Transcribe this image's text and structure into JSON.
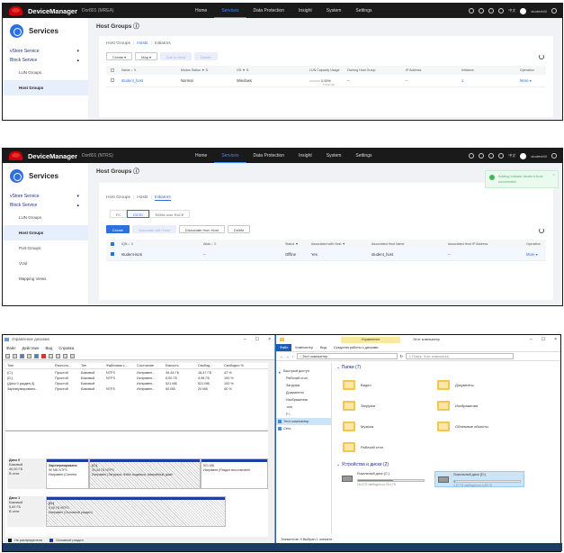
{
  "dm": {
    "brand": "DeviceManager",
    "device": "Dor801 (MREA)",
    "device2": "Dor801 (NTRS)",
    "nav": [
      "Home",
      "Services",
      "Data Protection",
      "Insight",
      "System",
      "Settings"
    ],
    "nav_active": "Services",
    "lang": "中文",
    "user": "student40",
    "section": "Services",
    "page_title": "Host Groups"
  },
  "panel1": {
    "sidebar": [
      "vStore Service",
      "Block Service",
      "LUN Groups",
      "Host Groups"
    ],
    "tabs": [
      "Host Groups",
      "Hosts",
      "Initiators"
    ],
    "buttons": [
      "Create",
      "Map",
      "Add to Host",
      "Delete"
    ],
    "columns": [
      "Name",
      "Modes Status",
      "OS",
      "LUN Capacity Usage",
      "Owning Host Group",
      "IP Address",
      "Initiators",
      "Operation"
    ],
    "row": {
      "name": "student_host",
      "status": "Normal",
      "os": "Windows",
      "usage": "0.00%",
      "usage_sub": "0.000 GB",
      "group": "--",
      "ip": "--",
      "initiators": "1",
      "op": "More"
    }
  },
  "panel2": {
    "sidebar": [
      "vStore Service",
      "Block Service",
      "LUN Groups",
      "Host Groups",
      "Port Groups",
      "VVol",
      "Mapping Views"
    ],
    "tabs": [
      "Host Groups",
      "Hosts",
      "Initiators"
    ],
    "subtabs": [
      "FC",
      "iSCSI",
      "NVMe over RoCE"
    ],
    "buttons": [
      "Create",
      "Associate with Host",
      "Dissociate from Host",
      "Delete"
    ],
    "columns": [
      "IQN",
      "Alias",
      "Status",
      "Associated with Host",
      "Associated Host Name",
      "Associated Host IP Address",
      "Operation"
    ],
    "row": {
      "iqn": "student-iscsi",
      "alias": "--",
      "status": "Offline",
      "assoc": "Yes",
      "host": "student_host",
      "ip": "--",
      "op": "More"
    },
    "toast": "Adding initiator student-host succeeded."
  },
  "diskmgmt": {
    "title": "Управление дисками",
    "menu": [
      "Файл",
      "Действие",
      "Вид",
      "Справка"
    ],
    "columns": [
      "Том",
      "Располо...",
      "Тип",
      "Файловая с...",
      "Состояние",
      "Емкость",
      "Свобод...",
      "Свободно %"
    ],
    "volumes": [
      [
        "(C:)",
        "Простой",
        "Базовый",
        "NTFS",
        "Исправен...",
        "39,44 ГБ",
        "18,47 ГБ",
        "47 %"
      ],
      [
        "(D:)",
        "Простой",
        "Базовый",
        "NTFS",
        "Исправен...",
        "5,00 ГБ",
        "4,98 ГБ",
        "100 %"
      ],
      [
        "(Диск 0 раздел 3)",
        "Простой",
        "Базовый",
        "",
        "Исправен...",
        "521 МБ",
        "521 МБ",
        "100 %"
      ],
      [
        "Зарезервировано...",
        "Простой",
        "Базовый",
        "NTFS",
        "Исправен...",
        "50 МБ",
        "20 МБ",
        "40 %"
      ]
    ],
    "disk0": {
      "name": "Диск 0",
      "type": "Базовый",
      "size": "40,00 ГБ",
      "state": "В сети"
    },
    "disk0_parts": [
      {
        "title": "Зарезервировано",
        "l1": "50 МБ NTFS",
        "l2": "Исправен (Систем"
      },
      {
        "title": "(C:)",
        "l1": "39,44 ГБ NTFS",
        "l2": "Исправен (Загрузка, Файл подкачки, Аварийный дамп"
      },
      {
        "title": "",
        "l1": "521 МБ",
        "l2": "Исправен (Раздел восстановле"
      }
    ],
    "disk1": {
      "name": "Диск 1",
      "type": "Базовый",
      "size": "5,00 ГБ",
      "state": "В сети"
    },
    "disk1_part": {
      "title": "(D:)",
      "l1": "5,00 ГБ NTFS",
      "l2": "Исправен (Основной раздел)"
    },
    "legend": [
      "Не распределена",
      "Основной раздел"
    ]
  },
  "explorer": {
    "manage": "Управление",
    "title": "Этот компьютер",
    "ribbon": [
      "Файл",
      "Компьютер",
      "Вид",
      "Средства работы с дисками"
    ],
    "address": "Этот компьютер",
    "search": "Поиск: Этот компьютер",
    "nav": [
      "Быстрый доступ",
      "Рабочий стол",
      "Загрузки",
      "Документы",
      "Изображения",
      ".ssh",
      "F:\\",
      "Этот компьютер",
      "Сеть"
    ],
    "folders_header": "Папки (7)",
    "folders": [
      "Видео",
      "Документы",
      "Загрузки",
      "Изображения",
      "Музыка",
      "Объемные объекты",
      "Рабочий стол"
    ],
    "drives_header": "Устройства и диски (2)",
    "drives": [
      {
        "name": "Локальный диск (C:)",
        "free": "18,4 ГБ свободно из 39,4 ГБ",
        "used": 0.53
      },
      {
        "name": "Локальный диск (D:)",
        "free": "4,97 ГБ свободно из 4,99 ГБ",
        "used": 0.01
      }
    ],
    "status": "Элементов: 9    Выбран 1 элемент"
  }
}
